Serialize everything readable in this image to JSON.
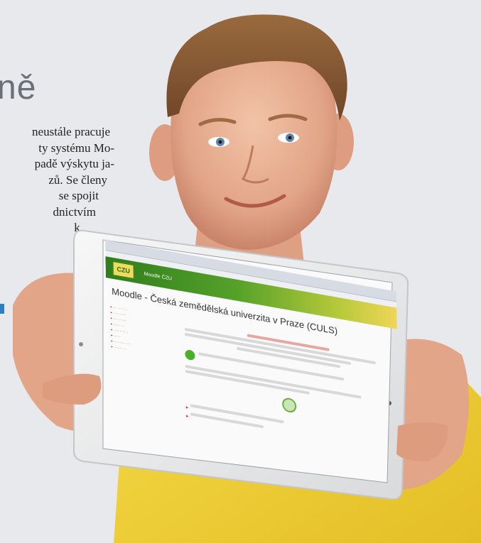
{
  "page": {
    "heading_fragment": "ně",
    "paragraph_lines": [
      "neustále pracuje",
      "ty systému Mo-",
      "padě výskytu ja-",
      "zů. Se členy",
      "se spojit",
      "dnictvím",
      "k."
    ],
    "accent_color": "#2f7fbd"
  },
  "tablet": {
    "header_link": "Moodle ČZU",
    "moodle_title": "Moodle - Česká zemědělská univerzita v Praze (CULS)",
    "logo_text": "CZU",
    "header_gradient": [
      "#2f7d1c",
      "#b7c93a",
      "#f0d658"
    ]
  },
  "person": {
    "shirt_color": "#f2d23a",
    "hair_color": "#8a5a32"
  }
}
